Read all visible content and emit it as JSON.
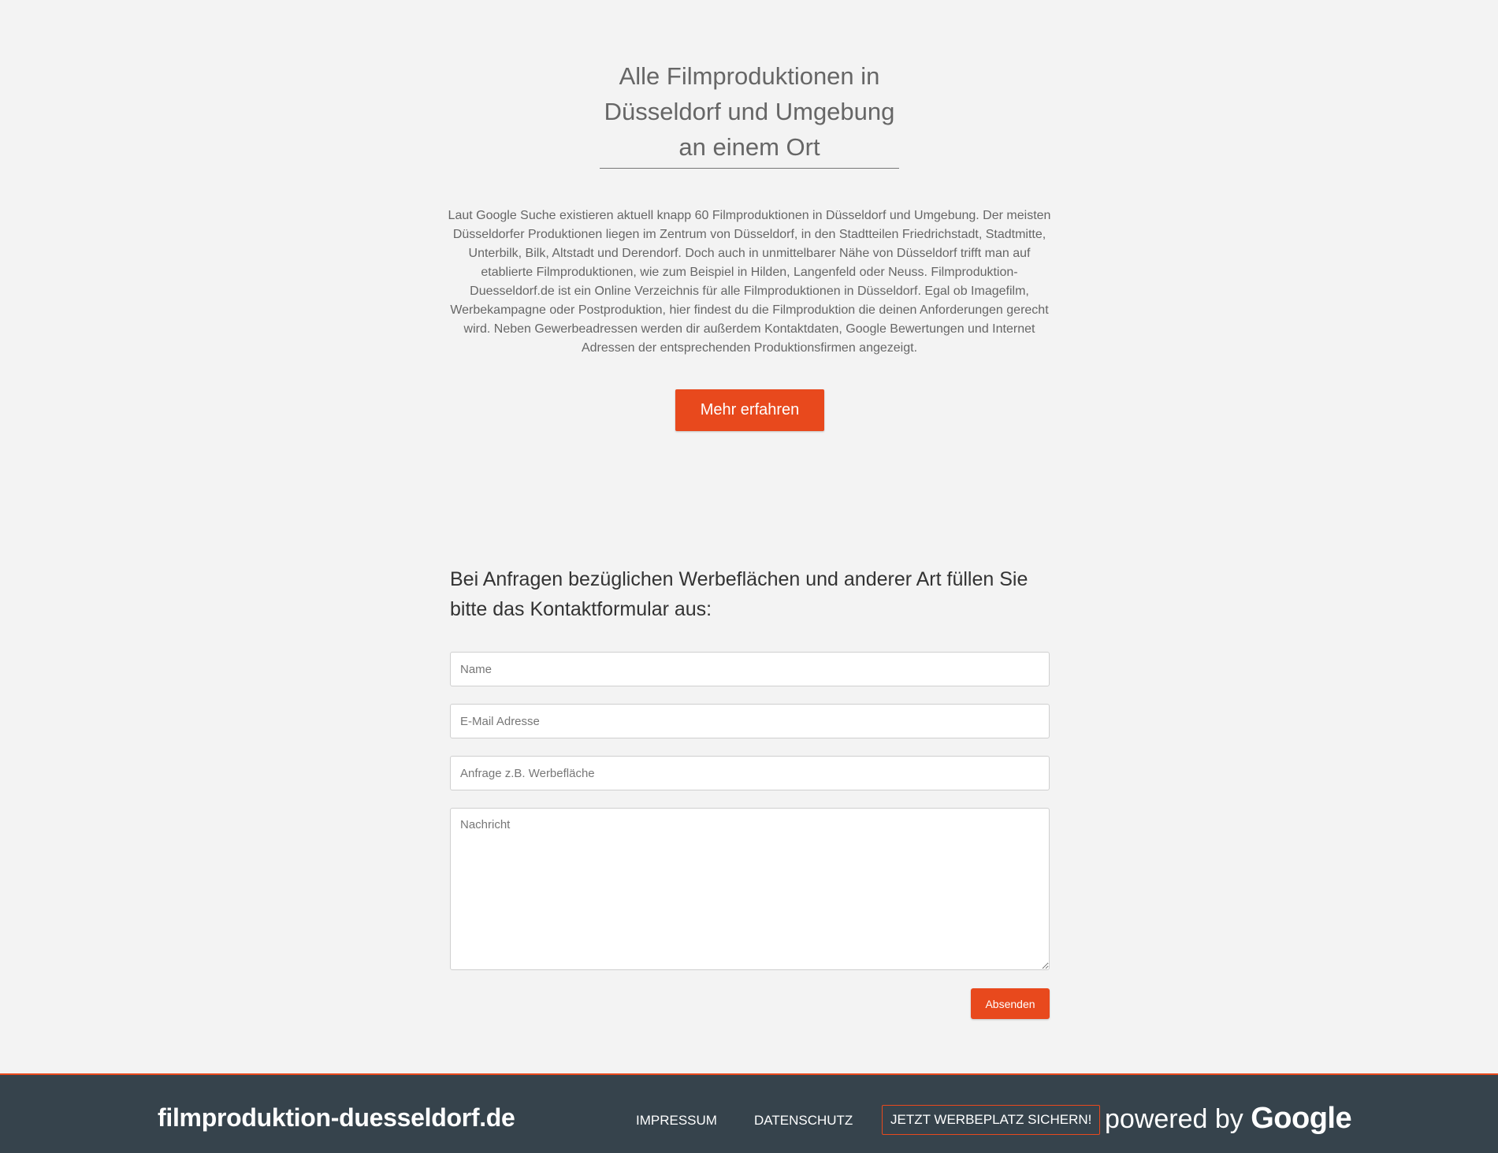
{
  "hero": {
    "title_lines": [
      "Alle Filmproduktionen in",
      "Düsseldorf und Umgebung",
      "an einem Ort"
    ],
    "intro": "Laut Google Suche existieren aktuell knapp 60 Filmproduktionen in Düsseldorf und Umgebung. Der meisten Düsseldorfer Produktionen liegen im Zentrum von Düsseldorf, in den Stadtteilen Friedrichstadt, Stadtmitte, Unterbilk, Bilk, Altstadt und Derendorf. Doch auch in unmittelbarer Nähe von Düsseldorf trifft man auf etablierte Filmproduktionen, wie zum Beispiel in Hilden, Langenfeld oder Neuss. Filmproduktion-Duesseldorf.de ist ein Online Verzeichnis für alle Filmproduktionen in Düsseldorf. Egal ob Imagefilm, Werbekampagne oder Postproduktion, hier findest du die Filmproduktion die deinen Anforderungen gerecht wird. Neben Gewerbeadressen werden dir außerdem Kontaktdaten, Google Bewertungen und Internet Adressen der entsprechenden Produktionsfirmen angezeigt.",
    "cta_label": "Mehr erfahren"
  },
  "contact": {
    "heading": "Bei Anfragen bezüglichen Werbeflächen und anderer Art füllen Sie bitte das Kontaktformular aus:",
    "name_placeholder": "Name",
    "email_placeholder": "E-Mail Adresse",
    "subject_placeholder": "Anfrage z.B. Werbefläche",
    "message_placeholder": "Nachricht",
    "submit_label": "Absenden"
  },
  "footer": {
    "brand": "filmproduktion-duesseldorf.de",
    "nav": [
      "IMPRESSUM",
      "DATENSCHUTZ",
      "JETZT WERBEPLATZ SICHERN!"
    ],
    "powered_by": "powered by",
    "powered_brand": "Google"
  },
  "colors": {
    "accent": "#e8491d",
    "footer_bg": "#36434c",
    "page_bg": "#f3f3f3"
  }
}
